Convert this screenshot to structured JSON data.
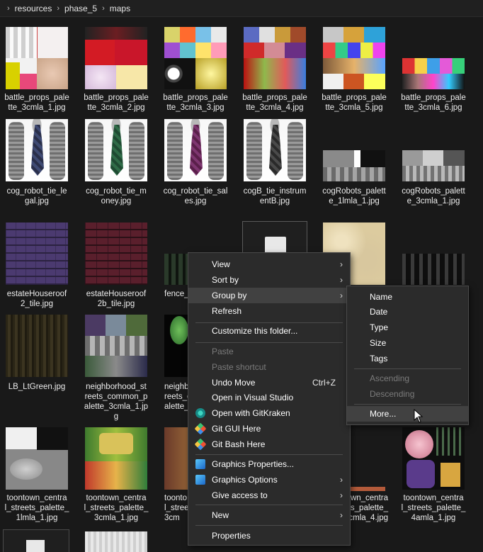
{
  "address_bar": {
    "crumbs": [
      "resources",
      "phase_5",
      "maps"
    ]
  },
  "files": [
    {
      "caption": "battle_props_pale\ntte_3cmla_1.jpg"
    },
    {
      "caption": "battle_props_pale\ntte_3cmla_2.jpg"
    },
    {
      "caption": "battle_props_pale\ntte_3cmla_3.jpg"
    },
    {
      "caption": "battle_props_pale\ntte_3cmla_4.jpg"
    },
    {
      "caption": "battle_props_pale\ntte_3cmla_5.jpg"
    },
    {
      "caption": "battle_props_pale\ntte_3cmla_6.jpg"
    },
    {
      "caption": "cog_robot_tie_le\ngal.jpg"
    },
    {
      "caption": "cog_robot_tie_m\noney.jpg"
    },
    {
      "caption": "cog_robot_tie_sal\nes.jpg"
    },
    {
      "caption": "cogB_tie_instrum\nentB.jpg"
    },
    {
      "caption": "cogRobots_palett\ne_1lmla_1.jpg"
    },
    {
      "caption": "cogRobots_palett\ne_3cmla_1.jpg"
    },
    {
      "caption": "estateHouseroof\n2_tile.jpg"
    },
    {
      "caption": "estateHouseroof\n2b_tile.jpg"
    },
    {
      "caption": "fence_"
    },
    {
      "caption": ""
    },
    {
      "caption": ""
    },
    {
      "caption": ""
    },
    {
      "caption": "LB_LtGreen.jpg"
    },
    {
      "caption": "neighborhood_st\nreets_common_p\nalette_3cmla_1.jp\ng"
    },
    {
      "caption": "neighb\nreets_c\nalette_"
    },
    {
      "caption": "toontown_centra\nl_streets_palette_\n1lmla_1.jpg"
    },
    {
      "caption": "toontown_centra\nl_streets_palette_\n3cmla_1.jpg"
    },
    {
      "caption": "toonto\nl_stree\n3cm"
    },
    {
      "caption": "wn_centra\nl_streets_palette_\n3cmla_4.jpg"
    },
    {
      "caption": "toontown_centra\nl_streets_palette_\n4amla_1.jpg"
    }
  ],
  "context_menu": {
    "items": [
      {
        "label": "View",
        "submenu": true
      },
      {
        "label": "Sort by",
        "submenu": true
      },
      {
        "label": "Group by",
        "submenu": true
      },
      {
        "label": "Refresh"
      },
      {
        "label": "Customize this folder..."
      },
      {
        "label": "Paste",
        "disabled": true
      },
      {
        "label": "Paste shortcut",
        "disabled": true
      },
      {
        "label": "Undo Move",
        "shortcut": "Ctrl+Z"
      },
      {
        "label": "Open in Visual Studio"
      },
      {
        "label": "Open with GitKraken",
        "icon": "gitkraken-icon"
      },
      {
        "label": "Git GUI Here",
        "icon": "git-gui-icon"
      },
      {
        "label": "Git Bash Here",
        "icon": "git-bash-icon"
      },
      {
        "label": "Graphics Properties...",
        "icon": "graphics-icon"
      },
      {
        "label": "Graphics Options",
        "icon": "graphics-icon",
        "submenu": true
      },
      {
        "label": "Give access to",
        "submenu": true
      },
      {
        "label": "New",
        "submenu": true
      },
      {
        "label": "Properties"
      }
    ]
  },
  "group_by_submenu": {
    "items": [
      {
        "label": "Name"
      },
      {
        "label": "Date"
      },
      {
        "label": "Type"
      },
      {
        "label": "Size"
      },
      {
        "label": "Tags"
      },
      {
        "label": "Ascending",
        "disabled": true
      },
      {
        "label": "Descending",
        "disabled": true
      },
      {
        "label": "More..."
      }
    ]
  },
  "colors": {
    "background": "#191919",
    "menu_bg": "#2b2b2b",
    "menu_highlight": "#414141",
    "text": "#ffffff",
    "disabled_text": "#7b7b7b"
  }
}
